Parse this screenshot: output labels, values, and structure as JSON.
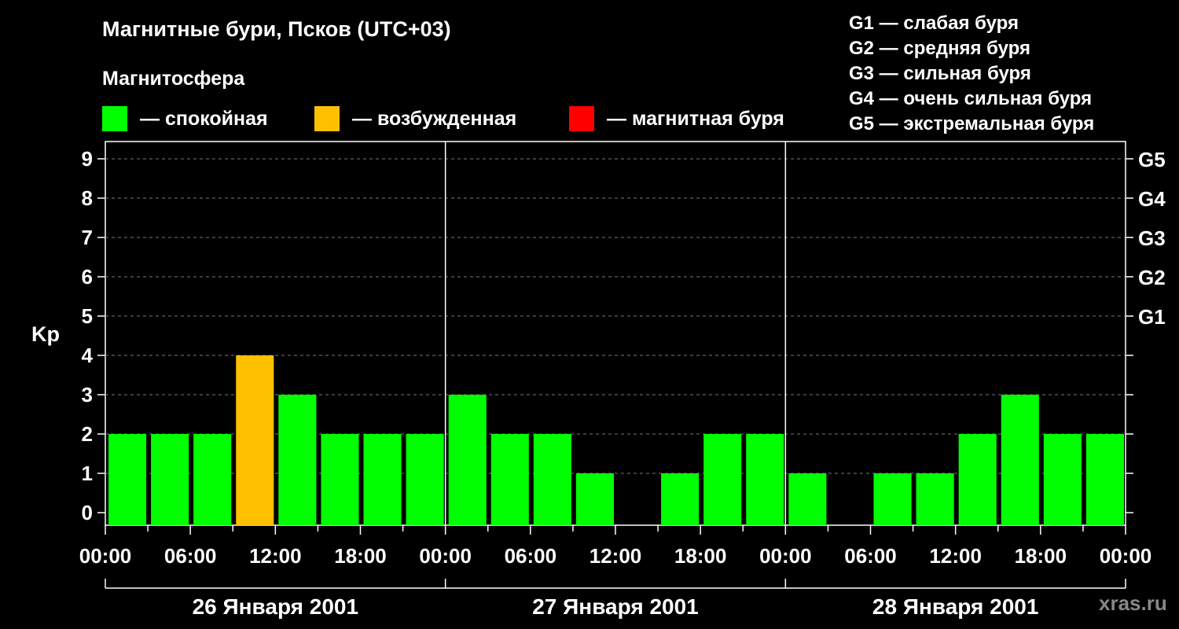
{
  "title": "Магнитные бури, Псков (UTC+03)",
  "subtitle": "Магнитосфера",
  "legend": [
    {
      "color": "#00ff00",
      "label": "— спокойная"
    },
    {
      "color": "#ffc000",
      "label": "— возбужденная"
    },
    {
      "color": "#ff0000",
      "label": "— магнитная буря"
    }
  ],
  "g_scale": [
    "G1 — слабая буря",
    "G2 — средняя буря",
    "G3 — сильная буря",
    "G4 — очень сильная буря",
    "G5 — экстремальная буря"
  ],
  "watermark": "xras.ru",
  "chart_data": {
    "type": "bar",
    "ylabel": "Kp",
    "ylim": [
      0,
      9
    ],
    "y_ticks": [
      "0",
      "1",
      "2",
      "3",
      "4",
      "5",
      "6",
      "7",
      "8",
      "9"
    ],
    "right_axis_ticks": [
      {
        "value": 5,
        "label": "G1"
      },
      {
        "value": 6,
        "label": "G2"
      },
      {
        "value": 7,
        "label": "G3"
      },
      {
        "value": 8,
        "label": "G4"
      },
      {
        "value": 9,
        "label": "G5"
      }
    ],
    "x_tick_labels": [
      "00:00",
      "06:00",
      "12:00",
      "18:00",
      "00:00",
      "06:00",
      "12:00",
      "18:00",
      "00:00",
      "06:00",
      "12:00",
      "18:00",
      "00:00"
    ],
    "days": [
      "26 Января 2001",
      "27 Января 2001",
      "28 Января 2001"
    ],
    "interval_hours": 3,
    "values": [
      2,
      2,
      2,
      4,
      3,
      2,
      2,
      2,
      3,
      2,
      2,
      1,
      0,
      1,
      2,
      2,
      1,
      0,
      1,
      1,
      2,
      3,
      2,
      2
    ],
    "colors": {
      "quiet": "#00ff00",
      "active": "#ffc000",
      "storm": "#ff0000"
    },
    "grid": true
  }
}
